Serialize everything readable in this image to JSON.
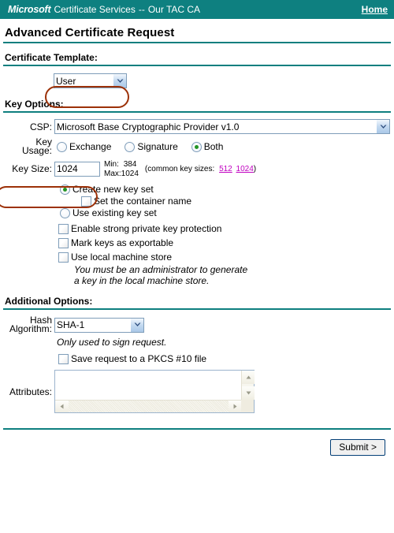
{
  "header": {
    "brand": "Microsoft",
    "product": "Certificate Services",
    "separator": "--",
    "ca_name": "Our TAC CA",
    "home_label": "Home",
    "bg_color": "#0e8080",
    "text_color": "#ffffff"
  },
  "page_title": "Advanced Certificate Request",
  "sections": {
    "certificate_template": {
      "heading": "Certificate Template:",
      "selected": "User",
      "options": [
        "User"
      ]
    },
    "key_options": {
      "heading": "Key Options:",
      "csp": {
        "label": "CSP:",
        "selected": "Microsoft Base Cryptographic Provider v1.0",
        "options": [
          "Microsoft Base Cryptographic Provider v1.0"
        ]
      },
      "key_usage": {
        "label_line1": "Key",
        "label_line2": "Usage:",
        "options": [
          {
            "label": "Exchange",
            "checked": false
          },
          {
            "label": "Signature",
            "checked": false
          },
          {
            "label": "Both",
            "checked": true
          }
        ]
      },
      "key_size": {
        "label": "Key Size:",
        "value": "1024",
        "min_label": "Min:",
        "min_value": "384",
        "max_label": "Max:",
        "max_value": "1024",
        "common_prefix": "(common key sizes:",
        "common_links": [
          "512",
          "1024"
        ],
        "common_suffix": ")",
        "link_color": "#c000c0"
      },
      "key_set": [
        {
          "label": "Create new key set",
          "type": "radio",
          "checked": true,
          "indent": 0
        },
        {
          "label": "Set the container name",
          "type": "checkbox",
          "checked": false,
          "indent": 1
        },
        {
          "label": "Use existing key set",
          "type": "radio",
          "checked": false,
          "indent": 0
        }
      ],
      "extra_checks": [
        {
          "label": "Enable strong private key protection",
          "checked": false
        },
        {
          "label": "Mark keys as exportable",
          "checked": false
        },
        {
          "label": "Use local machine store",
          "checked": false
        }
      ],
      "local_machine_note_line1": "You must be an administrator to generate",
      "local_machine_note_line2": "a key in the local machine store."
    },
    "additional_options": {
      "heading": "Additional Options:",
      "hash": {
        "label_line1": "Hash",
        "label_line2": "Algorithm:",
        "selected": "SHA-1",
        "options": [
          "SHA-1"
        ],
        "note": "Only used to sign request."
      },
      "save_pkcs": {
        "label": "Save request to a PKCS #10 file",
        "checked": false
      },
      "attributes": {
        "label": "Attributes:",
        "value": ""
      }
    }
  },
  "submit": {
    "label": "Submit >"
  },
  "annotations": {
    "color": "#9c3108",
    "boxes": [
      {
        "name": "certificate-template-highlight"
      },
      {
        "name": "key-size-highlight"
      }
    ]
  },
  "theme": {
    "rule_color": "#0e7f7f"
  }
}
